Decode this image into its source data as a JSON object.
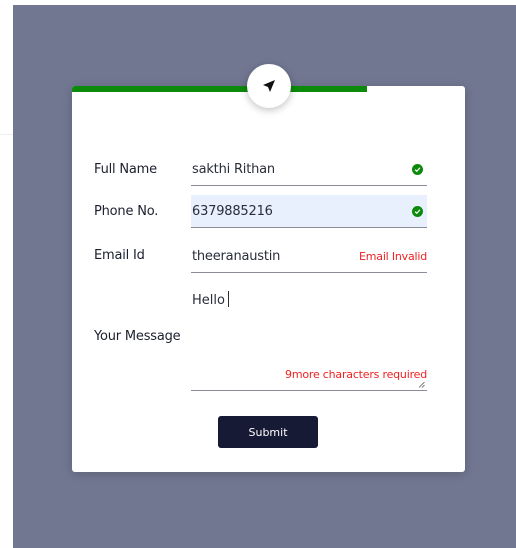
{
  "form": {
    "progress_percent": 75,
    "fields": {
      "full_name": {
        "label": "Full Name",
        "value": "sakthi Rithan",
        "valid": true
      },
      "phone": {
        "label": "Phone No.",
        "value": "6379885216",
        "valid": true
      },
      "email": {
        "label": "Email Id",
        "value": "theeranaustin",
        "error": "Email Invalid"
      },
      "message": {
        "label": "Your Message",
        "value": "Hello",
        "error": "9more characters required"
      }
    },
    "submit_label": "Submit"
  },
  "colors": {
    "backdrop": "#717791",
    "progress": "#0b8a0b",
    "valid": "#0b8a0b",
    "error": "#ee2222",
    "button": "#161a34",
    "active_field": "#e8f0fe"
  },
  "icons": {
    "badge": "send-arrow-icon",
    "valid": "check-circle-icon",
    "resize": "resize-handle-icon"
  }
}
